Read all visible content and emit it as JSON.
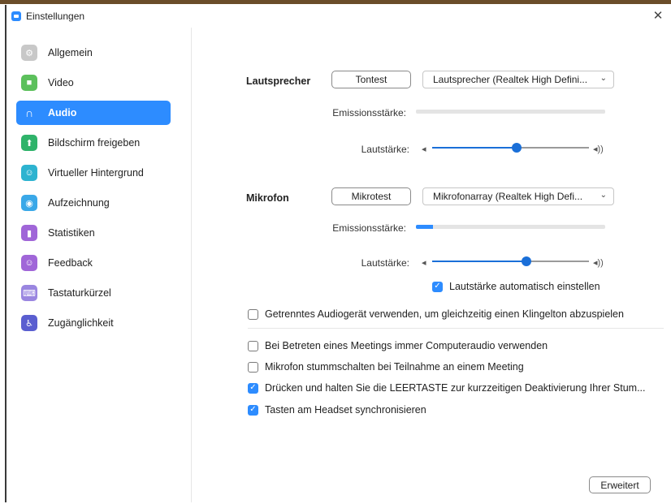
{
  "window": {
    "title": "Einstellungen",
    "close_glyph": "✕"
  },
  "colors": {
    "accent": "#2d8cff",
    "sidebar_active_bg": "#2d8cff"
  },
  "sidebar": {
    "items": [
      {
        "label": "Allgemein",
        "icon": "gear-icon",
        "glyph": "⚙",
        "color": "#c8c8c8",
        "active": false
      },
      {
        "label": "Video",
        "icon": "video-camera-icon",
        "glyph": "■",
        "color": "#5cc05c",
        "active": false
      },
      {
        "label": "Audio",
        "icon": "headphones-icon",
        "glyph": "∩",
        "color": "#2d8cff",
        "active": true
      },
      {
        "label": "Bildschirm freigeben",
        "icon": "share-screen-icon",
        "glyph": "⬆",
        "color": "#2fb36a",
        "active": false
      },
      {
        "label": "Virtueller Hintergrund",
        "icon": "virtual-background-icon",
        "glyph": "☺",
        "color": "#2db3d0",
        "active": false
      },
      {
        "label": "Aufzeichnung",
        "icon": "record-icon",
        "glyph": "◉",
        "color": "#3aa8e8",
        "active": false
      },
      {
        "label": "Statistiken",
        "icon": "statistics-icon",
        "glyph": "▮",
        "color": "#a066d8",
        "active": false
      },
      {
        "label": "Feedback",
        "icon": "feedback-icon",
        "glyph": "☺",
        "color": "#a066d8",
        "active": false
      },
      {
        "label": "Tastaturkürzel",
        "icon": "keyboard-icon",
        "glyph": "⌨",
        "color": "#9a86e0",
        "active": false
      },
      {
        "label": "Zugänglichkeit",
        "icon": "accessibility-icon",
        "glyph": "♿",
        "color": "#5a5ed0",
        "active": false
      }
    ]
  },
  "speaker": {
    "label": "Lautsprecher",
    "test_button": "Tontest",
    "device": "Lautsprecher (Realtek High Defini...",
    "level_label": "Emissionsstärke:",
    "level": 0,
    "volume_label": "Lautstärke:",
    "volume": 0.54
  },
  "mic": {
    "label": "Mikrofon",
    "test_button": "Mikrotest",
    "device": "Mikrofonarray (Realtek High Defi...",
    "level_label": "Emissionsstärke:",
    "level": 0.09,
    "volume_label": "Lautstärke:",
    "volume": 0.6,
    "auto_adjust": {
      "label": "Lautstärke automatisch einstellen",
      "checked": true
    }
  },
  "options": [
    {
      "label": "Getrenntes Audiogerät verwenden, um gleichzeitig einen Klingelton abzuspielen",
      "checked": false
    },
    {
      "label": "Bei Betreten eines Meetings immer Computeraudio verwenden",
      "checked": false
    },
    {
      "label": "Mikrofon stummschalten bei Teilnahme an einem Meeting",
      "checked": false
    },
    {
      "label": "Drücken und halten Sie die LEERTASTE zur kurzzeitigen Deaktivierung Ihrer Stum...",
      "checked": true
    },
    {
      "label": "Tasten am Headset synchronisieren",
      "checked": true
    }
  ],
  "advanced_button": "Erweitert",
  "glyphs": {
    "chevron": "⌄",
    "vol_low": "◂",
    "vol_high": "◂))",
    "check": "✓"
  }
}
